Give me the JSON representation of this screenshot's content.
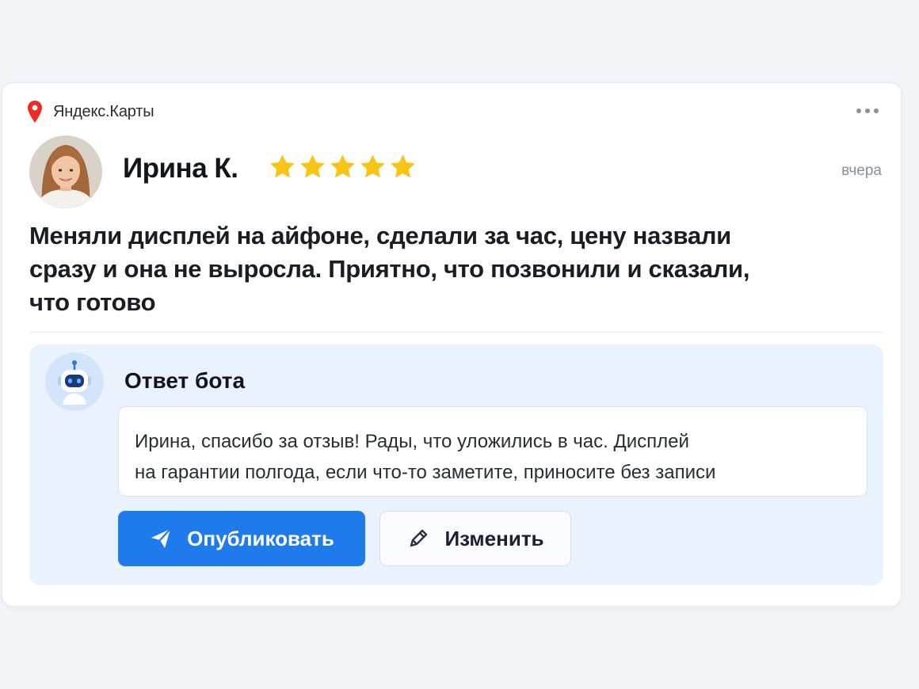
{
  "header": {
    "brand": "Яндекс.Карты",
    "brand_icon": "map-pin-icon",
    "more_icon": "more-options-icon"
  },
  "review": {
    "author": "Ирина К.",
    "rating": 5,
    "rating_max": 5,
    "date": "вчера",
    "text_lines": [
      "Меняли дисплей на айфоне, сделали за час, цену назвали",
      "сразу и она не выросла. Приятно, что позвонили и сказали,",
      "что готово"
    ]
  },
  "bot_reply": {
    "title": "Ответ бота",
    "text_lines": [
      "Ирина, спасибо за отзыв! Рады, что уложились в час. Дисплей",
      "на гарантии полгода, если что-то заметите, приносите без записи"
    ],
    "publish_label": "Опубликовать",
    "edit_label": "Изменить"
  },
  "colors": {
    "accent": "#1f7aec",
    "star": "#f8c516",
    "pin": "#ee2a24",
    "bot_panel": "#eaf2fd"
  }
}
